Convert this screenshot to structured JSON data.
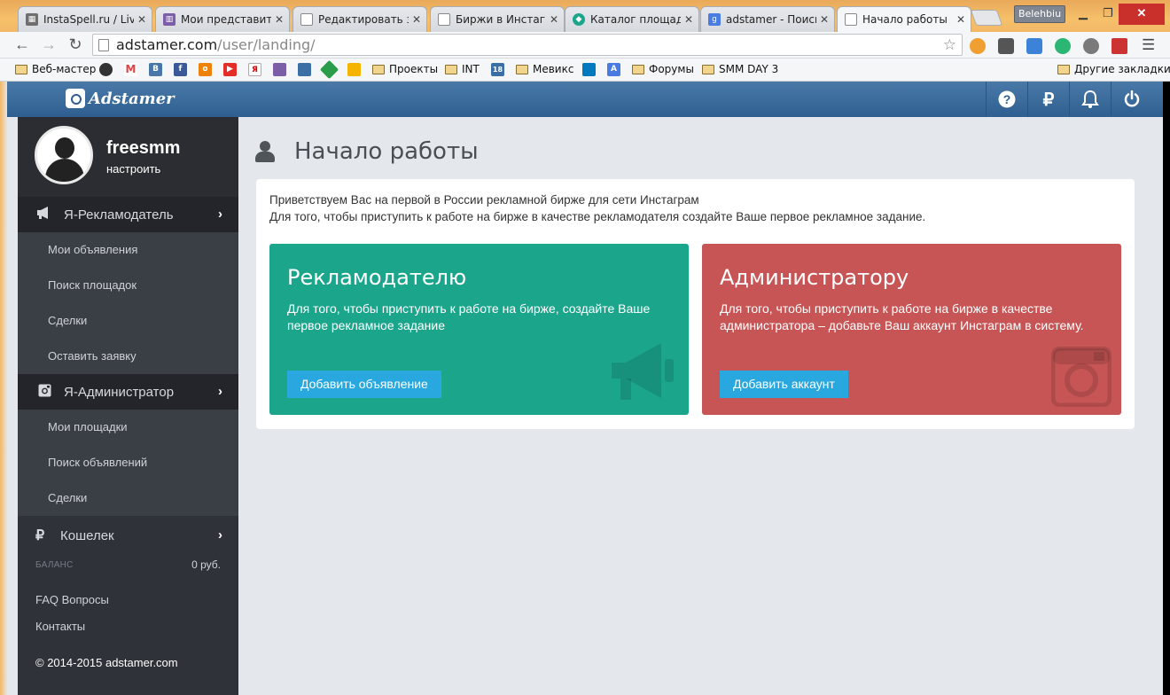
{
  "browser": {
    "tabs": [
      {
        "title": "InstaSpell.ru / Live",
        "favicon": "#6f6f6f"
      },
      {
        "title": "Мои представители",
        "favicon": "#7b5ea7"
      },
      {
        "title": "Редактировать за",
        "favicon": "#ffffff"
      },
      {
        "title": "Биржи в Инстагра",
        "favicon": "#ffffff"
      },
      {
        "title": "Каталог площадок",
        "favicon": "#1ba68c"
      },
      {
        "title": "adstamer - Поиск",
        "favicon": "#4a7be0"
      },
      {
        "title": "Начало работы",
        "favicon": "#ffffff",
        "active": true
      }
    ],
    "user_badge": "Belehbiu",
    "url_host": "adstamer.com",
    "url_path": "/user/landing/",
    "bookmarks": {
      "web_master": "Веб-мастер",
      "projects": "Проекты",
      "int": "INT",
      "calendar_badge": "18",
      "mevix": "Мевикс",
      "forums": "Форумы",
      "smm_day": "SMM DAY 3",
      "other": "Другие закладки"
    }
  },
  "app": {
    "logo_text": "Adstamer",
    "header_buttons": [
      "help-icon",
      "ruble-icon",
      "bell-icon",
      "power-icon"
    ]
  },
  "sidebar": {
    "username": "freesmm",
    "settings_link": "настроить",
    "advertiser": {
      "label": "Я-Рекламодатель",
      "items": [
        "Мои объявления",
        "Поиск площадок",
        "Сделки",
        "Оставить заявку"
      ]
    },
    "administrator": {
      "label": "Я-Администратор",
      "items": [
        "Мои площадки",
        "Поиск объявлений",
        "Сделки"
      ]
    },
    "wallet": {
      "label": "Кошелек",
      "balance_label": "БАЛАНС",
      "balance_value": "0 руб."
    },
    "faq": "FAQ Вопросы",
    "contacts": "Контакты",
    "copyright": "© 2014-2015 adstamer.com"
  },
  "main": {
    "title": "Начало работы",
    "welcome_line1": "Приветствуем Вас на первой в России рекламной бирже для сети Инстаграм",
    "welcome_line2": "Для того, чтобы приступить к работе на бирже в качестве рекламодателя создайте Ваше первое рекламное задание.",
    "advertiser_card": {
      "title": "Рекламодателю",
      "text": "Для того, чтобы приступить к работе на бирже, создайте Ваше первое рекламное задание",
      "button": "Добавить объявление",
      "color": "#1ba68c"
    },
    "admin_card": {
      "title": "Администратору",
      "text": "Для того, чтобы приступить к работе на бирже в качестве администратора – добавьте Ваш аккаунт Инстаграм в систему.",
      "button": "Добавить аккаунт",
      "color": "#c75555"
    }
  }
}
